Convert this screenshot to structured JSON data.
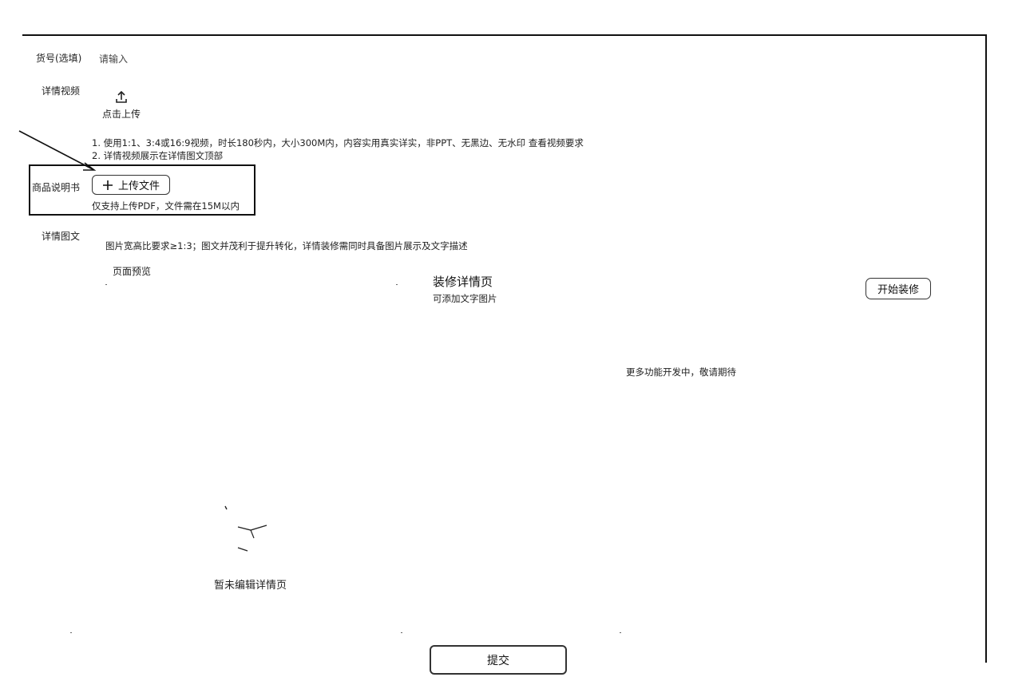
{
  "fields": {
    "item_number": {
      "label": "货号(选填)",
      "placeholder": "请输入"
    },
    "detail_video": {
      "label": "详情视频",
      "upload_label": "点击上传",
      "notes": [
        "1. 使用1:1、3:4或16:9视频，时长180秒内，大小300M内，内容实用真实详实，非PPT、无黑边、无水印 查看视频要求",
        "2. 详情视频展示在详情图文顶部"
      ]
    },
    "manual": {
      "label": "商品说明书",
      "upload_button": "上传文件",
      "hint": "仅支持上传PDF，文件需在15M以内"
    },
    "detail_graphic": {
      "label": "详情图文",
      "hint": "图片宽高比要求≥1:3；图文并茂利于提升转化，详情装修需同时具备图片展示及文字描述",
      "preview_label": "页面预览",
      "empty_text": "暂未编辑详情页",
      "decorate_title": "装修详情页",
      "decorate_subtitle": "可添加文字图片",
      "decorate_button": "开始装修",
      "more_features": "更多功能开发中，敬请期待"
    }
  },
  "footer": {
    "submit_label": "提交"
  },
  "icons": {
    "upload": "upload-icon",
    "plus": "plus-icon",
    "arrow": "annotation-arrow-icon",
    "empty": "empty-state-icon"
  }
}
